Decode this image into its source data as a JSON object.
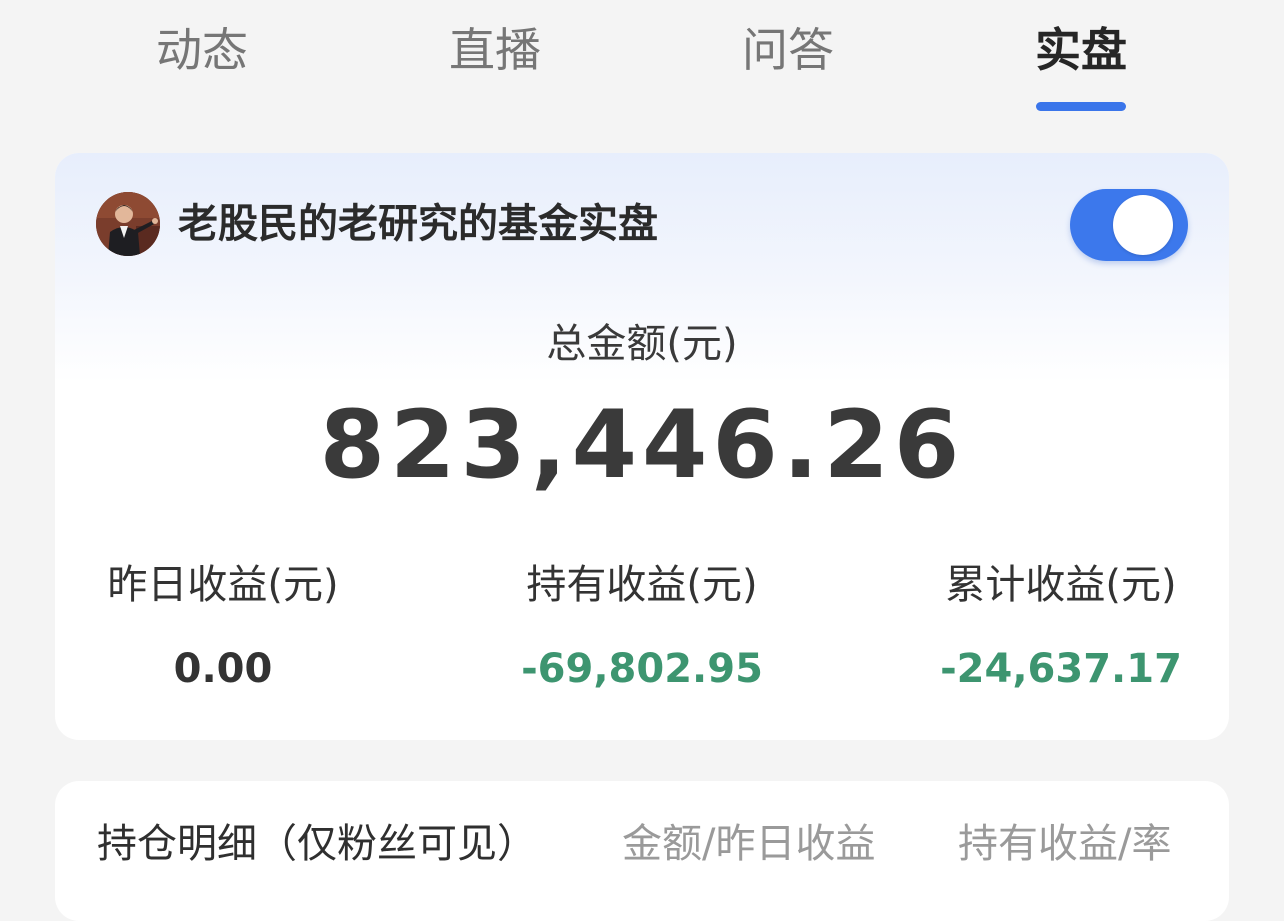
{
  "tabs": [
    {
      "label": "动态",
      "active": false
    },
    {
      "label": "直播",
      "active": false
    },
    {
      "label": "问答",
      "active": false
    },
    {
      "label": "实盘",
      "active": true
    }
  ],
  "colors": {
    "accent": "#3a75ea",
    "loss": "#3d9570",
    "background": "#f4f4f4"
  },
  "portfolio": {
    "name": "老股民的老研究的基金实盘",
    "visibility_toggle_on": true,
    "total_label": "总金额(元)",
    "total_value": "823,446.26",
    "stats": [
      {
        "label": "昨日收益(元)",
        "value": "0.00"
      },
      {
        "label": "持有收益(元)",
        "value": "-69,802.95"
      },
      {
        "label": "累计收益(元)",
        "value": "-24,637.17"
      }
    ]
  },
  "holdings": {
    "title": "持仓明细（仅粉丝可见）",
    "columns": [
      "金额/昨日收益",
      "持有收益/率"
    ]
  }
}
